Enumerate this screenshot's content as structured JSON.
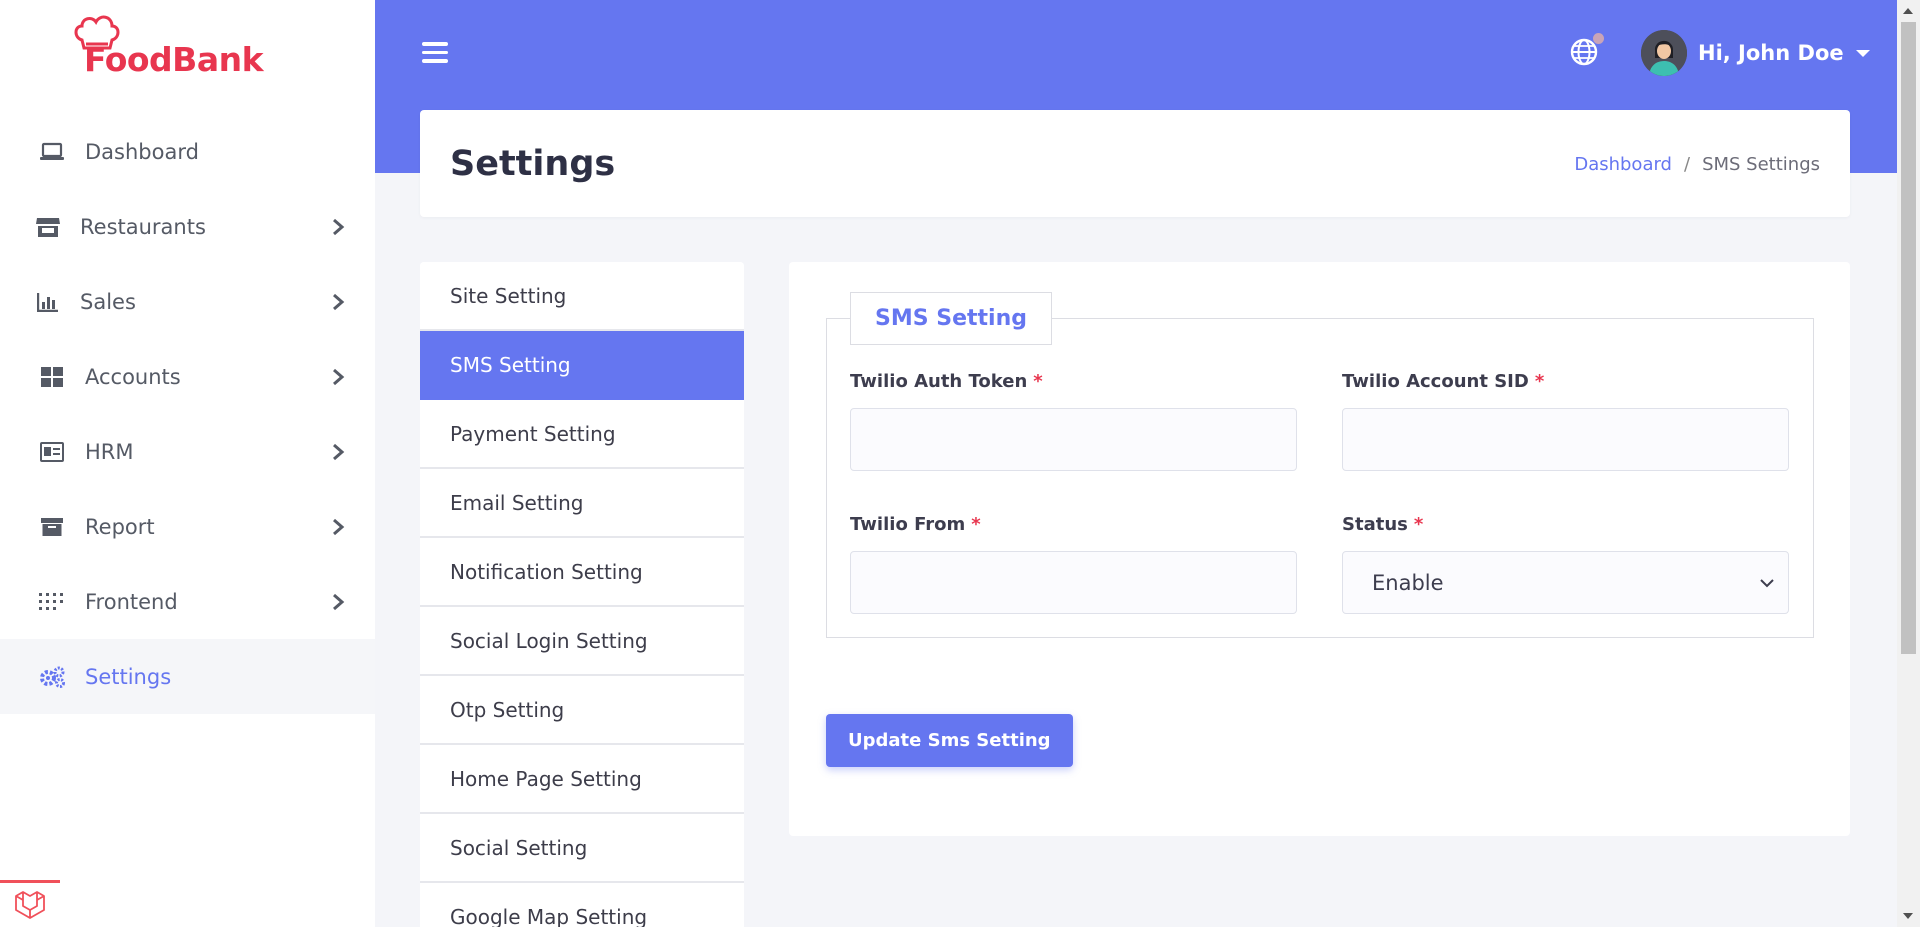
{
  "brand": {
    "name": "FoodBank",
    "primary_color": "#6576f0",
    "logo_color": "#e8364f"
  },
  "sidebar": {
    "items": [
      {
        "label": "Dashboard",
        "icon": "laptop-icon",
        "has_children": false,
        "active": false
      },
      {
        "label": "Restaurants",
        "icon": "store-icon",
        "has_children": true,
        "active": false
      },
      {
        "label": "Sales",
        "icon": "chart-bar-icon",
        "has_children": true,
        "active": false
      },
      {
        "label": "Accounts",
        "icon": "grid-icon",
        "has_children": true,
        "active": false
      },
      {
        "label": "HRM",
        "icon": "id-card-icon",
        "has_children": true,
        "active": false
      },
      {
        "label": "Report",
        "icon": "archive-icon",
        "has_children": true,
        "active": false
      },
      {
        "label": "Frontend",
        "icon": "dots-grid-icon",
        "has_children": true,
        "active": false
      },
      {
        "label": "Settings",
        "icon": "gears-icon",
        "has_children": false,
        "active": true
      }
    ]
  },
  "header": {
    "user_greeting": "Hi, John Doe"
  },
  "page": {
    "title": "Settings",
    "breadcrumb": {
      "home": "Dashboard",
      "separator": "/",
      "current": "SMS Settings"
    }
  },
  "settings_menu": {
    "items": [
      {
        "label": "Site Setting",
        "active": false
      },
      {
        "label": "SMS Setting",
        "active": true
      },
      {
        "label": "Payment Setting",
        "active": false
      },
      {
        "label": "Email Setting",
        "active": false
      },
      {
        "label": "Notification Setting",
        "active": false
      },
      {
        "label": "Social Login Setting",
        "active": false
      },
      {
        "label": "Otp Setting",
        "active": false
      },
      {
        "label": "Home Page Setting",
        "active": false
      },
      {
        "label": "Social Setting",
        "active": false
      },
      {
        "label": "Google Map Setting",
        "active": false
      }
    ]
  },
  "form": {
    "legend": "SMS Setting",
    "required_mark": "*",
    "fields": {
      "auth_token": {
        "label": "Twilio Auth Token",
        "value": ""
      },
      "account_sid": {
        "label": "Twilio Account SID",
        "value": ""
      },
      "from": {
        "label": "Twilio From",
        "value": ""
      },
      "status": {
        "label": "Status",
        "value": "Enable"
      }
    },
    "submit_label": "Update Sms Setting"
  }
}
